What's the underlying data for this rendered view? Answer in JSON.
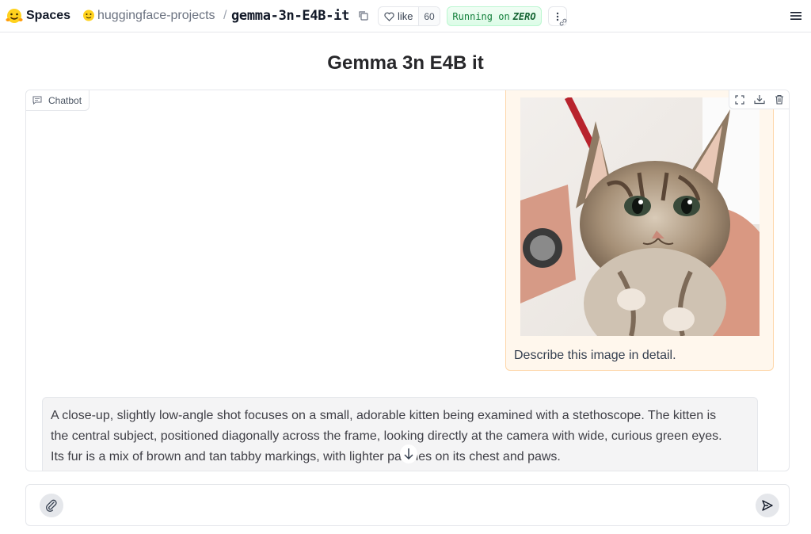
{
  "header": {
    "brand": "Spaces",
    "org": "huggingface-projects",
    "separator": "/",
    "repo": "gemma-3n-E4B-it",
    "like_label": "like",
    "like_count": "60",
    "status_prefix": "Running on",
    "status_hardware": "ZERO"
  },
  "page": {
    "title": "Gemma 3n E4B it"
  },
  "chatbot": {
    "label": "Chatbot",
    "messages": [
      {
        "role": "user",
        "image": "kitten-with-stethoscope",
        "text": "Describe this image in detail."
      },
      {
        "role": "assistant",
        "text_line1": "A close-up, slightly low-angle shot focuses on a small, adorable kitten being examined with a stethoscope. The kitten is",
        "text_line2": "the central subject, positioned diagonally across the frame, looking directly at the camera with wide, curious green eyes.",
        "text_line3": "Its fur is a mix of brown and tan tabby markings, with lighter patches on its chest and paws."
      }
    ]
  },
  "input": {
    "placeholder": "",
    "value": ""
  },
  "colors": {
    "user_bubble": "#fff7ed",
    "bot_bubble": "#f4f4f5",
    "running_green": "#15803d"
  }
}
